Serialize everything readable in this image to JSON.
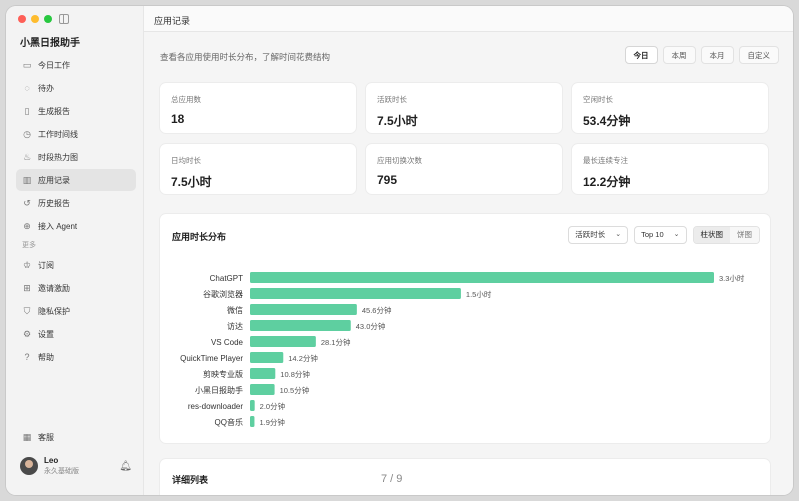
{
  "app": {
    "title": "小黑日报助手",
    "traffic_colors": [
      "#fe5f57",
      "#febc2e",
      "#28c840"
    ]
  },
  "sidebar": {
    "items": [
      {
        "label": "今日工作",
        "icon": "calendar-icon"
      },
      {
        "label": "待办",
        "icon": "check-circle-icon"
      },
      {
        "label": "生成报告",
        "icon": "document-icon"
      },
      {
        "label": "工作时间线",
        "icon": "clock-icon"
      },
      {
        "label": "时段热力图",
        "icon": "flame-icon"
      },
      {
        "label": "应用记录",
        "icon": "bar-chart-icon",
        "active": true
      },
      {
        "label": "历史报告",
        "icon": "history-icon"
      },
      {
        "label": "接入 Agent",
        "icon": "link-icon"
      }
    ],
    "section_more": "更多",
    "more_items": [
      {
        "label": "订阅",
        "icon": "crown-icon"
      },
      {
        "label": "邀请激励",
        "icon": "gift-icon"
      },
      {
        "label": "隐私保护",
        "icon": "shield-icon"
      },
      {
        "label": "设置",
        "icon": "gear-icon"
      },
      {
        "label": "帮助",
        "icon": "help-icon"
      }
    ],
    "support": {
      "label": "客服",
      "icon": "qr-code-icon"
    },
    "user": {
      "name": "Leo",
      "plan": "永久基础版"
    }
  },
  "header": {
    "title": "应用记录"
  },
  "main": {
    "subtitle": "查看各应用使用时长分布，了解时间花费结构",
    "range_tabs": [
      "今日",
      "本周",
      "本月",
      "自定义"
    ],
    "range_active": "今日",
    "stats": [
      {
        "label": "总应用数",
        "value": "18"
      },
      {
        "label": "活跃时长",
        "value": "7.5小时"
      },
      {
        "label": "空闲时长",
        "value": "53.4分钟"
      },
      {
        "label": "日均时长",
        "value": "7.5小时"
      },
      {
        "label": "应用切换次数",
        "value": "795"
      },
      {
        "label": "最长连续专注",
        "value": "12.2分钟"
      }
    ],
    "chart": {
      "title": "应用时长分布",
      "metric_select": "活跃时长",
      "top_select": "Top 10",
      "view_modes": [
        "柱状图",
        "饼图"
      ],
      "view_active": "柱状图"
    },
    "detail": {
      "title": "详细列表"
    }
  },
  "pager": "7 / 9",
  "chart_data": {
    "type": "bar",
    "orientation": "horizontal",
    "color": "#5ecfa0",
    "unit": "minutes",
    "categories": [
      "ChatGPT",
      "谷歌浏览器",
      "微信",
      "访达",
      "VS Code",
      "QuickTime Player",
      "剪映专业版",
      "小黑日报助手",
      "res-downloader",
      "QQ音乐"
    ],
    "values": [
      198,
      90,
      45.6,
      43.0,
      28.1,
      14.2,
      10.8,
      10.5,
      2.0,
      1.9
    ],
    "value_labels": [
      "3.3小时",
      "1.5小时",
      "45.6分钟",
      "43.0分钟",
      "28.1分钟",
      "14.2分钟",
      "10.8分钟",
      "10.5分钟",
      "2.0分钟",
      "1.9分钟"
    ]
  }
}
